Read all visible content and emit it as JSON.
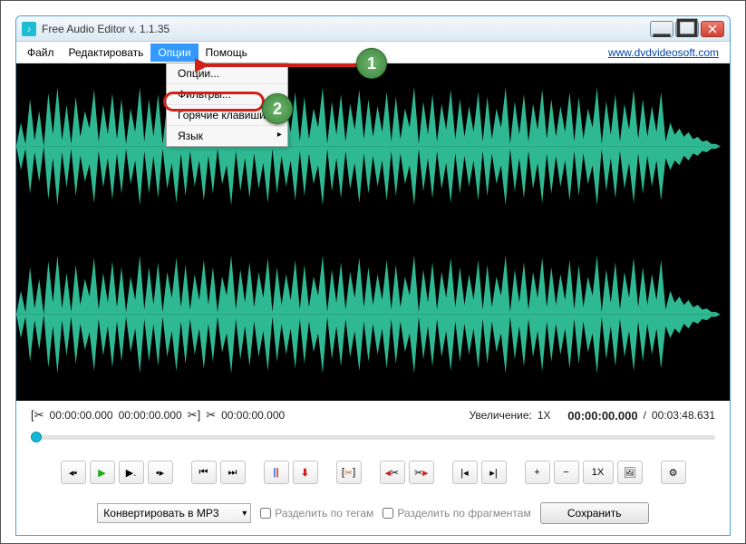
{
  "window": {
    "title": "Free Audio Editor v. 1.1.35"
  },
  "menubar": {
    "file": "Файл",
    "edit": "Редактировать",
    "options": "Опции",
    "help": "Помощь",
    "site_link": "www.dvdvideosoft.com"
  },
  "dropdown": {
    "options_item": "Опции...",
    "filters_item": "Фильтры...",
    "hotkeys_item": "Горячие клавиши",
    "language_item": "Язык"
  },
  "time_row": {
    "sel_start": "00:00:00.000",
    "sel_end": "00:00:00.000",
    "cursor_pos": "00:00:00.000",
    "zoom_label": "Увеличение:",
    "zoom_value": "1X",
    "current": "00:00:00.000",
    "slash": "/",
    "total": "00:03:48.631"
  },
  "footer": {
    "convert_label": "Конвертировать в MP3",
    "split_tags": "Разделить по тегам",
    "split_fragments": "Разделить по фрагментам",
    "save": "Сохранить"
  },
  "toolbar": {
    "zoom_level": "1X"
  },
  "annotations": {
    "badge1": "1",
    "badge2": "2"
  }
}
